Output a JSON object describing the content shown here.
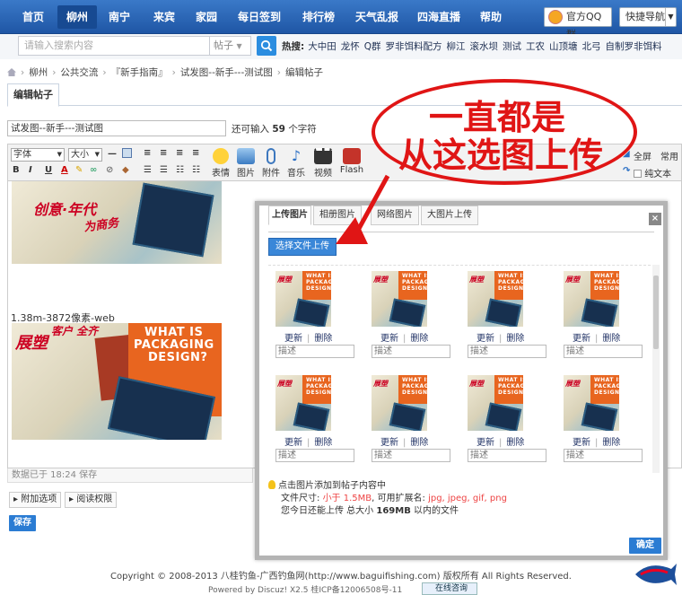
{
  "nav": {
    "items": [
      "首页",
      "柳州",
      "南宁",
      "来宾",
      "家园",
      "每日签到",
      "排行榜",
      "天气乱报",
      "四海直播",
      "帮助"
    ],
    "active_index": 1,
    "qq_label": "官方QQ群",
    "quick_nav_label": "快捷导航"
  },
  "search": {
    "placeholder": "请输入搜索内容",
    "type": "帖子",
    "hot_label": "热搜:",
    "hot_items": [
      "大中田",
      "龙怀",
      "Q群",
      "罗非饵料配方",
      "柳江",
      "滚水坝",
      "测试",
      "工农",
      "山顶塘",
      "北弓",
      "自制罗非饵料"
    ]
  },
  "breadcrumb": [
    "柳州",
    "公共交流",
    "『新手指南』",
    "试发图--新手---测试图",
    "编辑帖子"
  ],
  "edit_tab": "编辑帖子",
  "post": {
    "title": "试发图--新手---测试图",
    "remain_prefix": "还可输入",
    "remain_count": "59",
    "remain_suffix": "个字符"
  },
  "toolbar": {
    "font": "字体",
    "size": "大小",
    "buttons": [
      "表情",
      "图片",
      "附件",
      "音乐",
      "视频",
      "Flash"
    ],
    "fullscreen": "全屏",
    "common": "常用",
    "plaintext": "纯文本"
  },
  "editor": {
    "caption": "1.38m-3872像素-web",
    "image_text_1": "WHAT IS",
    "image_text_2": "PACKAGING",
    "image_text_3": "DESIGN?",
    "status": "数据已于 18:24 保存"
  },
  "options": {
    "attach": "附加选项",
    "read_perm": "阅读权限",
    "save": "保存"
  },
  "dialog": {
    "tabs": [
      "上传图片",
      "相册图片",
      "网络图片",
      "大图片上传"
    ],
    "active_tab": 0,
    "choose_label": "选择文件上传",
    "update_label": "更新",
    "delete_label": "删除",
    "desc_placeholder": "描述",
    "tip_line1": "点击图片添加到帖子内容中",
    "tip_line2_prefix": "文件尺寸:",
    "tip_size": "小于 1.5MB",
    "tip_line2_mid": ", 可用扩展名:",
    "tip_exts": "jpg, jpeg, gif, png",
    "tip_line3_prefix": "您今日还能上传 总大小",
    "tip_total": "169MB",
    "tip_line3_suffix": "以内的文件",
    "ok": "确定",
    "thumb_count": 8
  },
  "annotation": {
    "line1": "一直都是",
    "line2": "从这选图上传",
    "color": "#e01515"
  },
  "footer": {
    "copyright": "Copyright © 2008-2013 八桂钓鱼-广西钓鱼网(http://www.baguifishing.com) 版权所有 All Rights Reserved.",
    "powered": "Powered by Discuz! X2.5  桂ICP备12006508号-11",
    "online": "在线咨询"
  },
  "colors": {
    "nav_bg": "#2a66b5",
    "accent": "#2b7cd3",
    "annotation": "#e01515"
  }
}
